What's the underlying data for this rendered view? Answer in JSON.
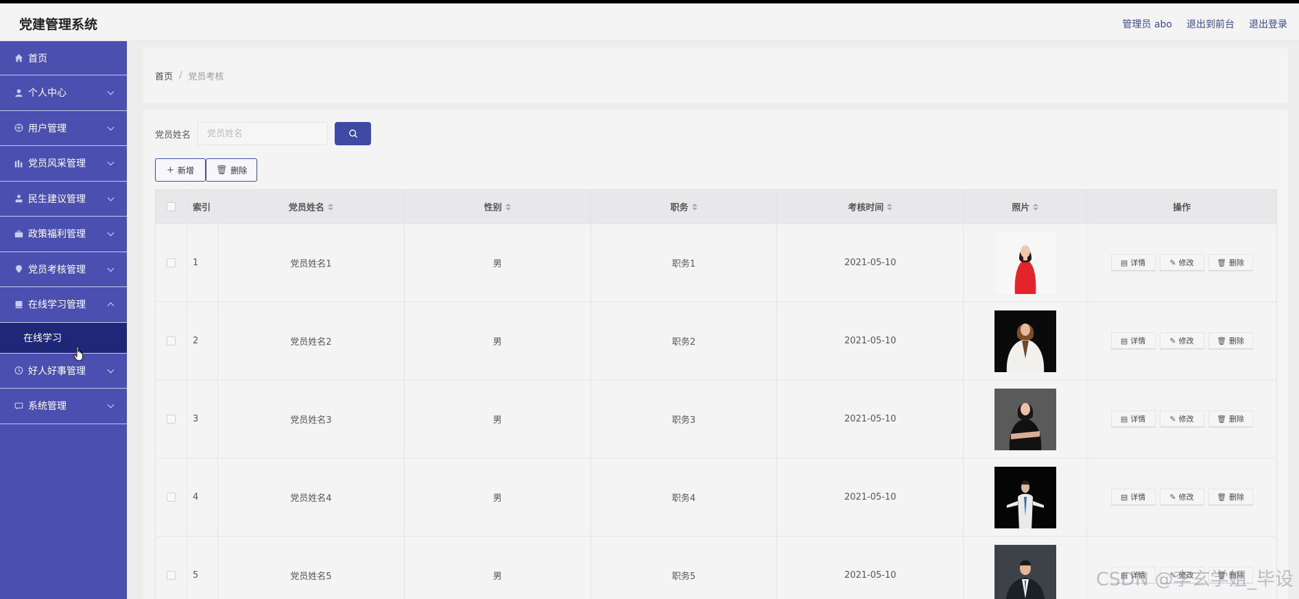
{
  "app": {
    "title": "党建管理系统"
  },
  "header": {
    "user": "管理员 abo",
    "front": "退出到前台",
    "logout": "退出登录"
  },
  "sidebar": {
    "items": [
      {
        "label": "首页",
        "icon": "home-icon"
      },
      {
        "label": "个人中心",
        "icon": "user-icon"
      },
      {
        "label": "用户管理",
        "icon": "users-icon"
      },
      {
        "label": "党员风采管理",
        "icon": "chart-icon"
      },
      {
        "label": "民生建议管理",
        "icon": "person-icon"
      },
      {
        "label": "政策福利管理",
        "icon": "briefcase-icon"
      },
      {
        "label": "党员考核管理",
        "icon": "location-icon"
      },
      {
        "label": "在线学习管理",
        "icon": "book-icon",
        "expanded": true,
        "sub": "在线学习"
      },
      {
        "label": "好人好事管理",
        "icon": "clock-icon"
      },
      {
        "label": "系统管理",
        "icon": "message-icon"
      }
    ]
  },
  "breadcrumb": {
    "home": "首页",
    "sep": "/",
    "current": "党员考核"
  },
  "search": {
    "label": "党员姓名",
    "placeholder": "党员姓名",
    "value": ""
  },
  "toolbar": {
    "add": "新增",
    "delete": "删除"
  },
  "table": {
    "headers": {
      "index": "索引",
      "name": "党员姓名",
      "gender": "性别",
      "position": "职务",
      "time": "考核时间",
      "photo": "照片",
      "ops": "操作"
    },
    "ops": {
      "detail": "详情",
      "edit": "修改",
      "delete": "删除"
    },
    "rows": [
      {
        "index": "1",
        "name": "党员姓名1",
        "gender": "男",
        "position": "职务1",
        "time": "2021-05-10",
        "photo": "woman-red-dress"
      },
      {
        "index": "2",
        "name": "党员姓名2",
        "gender": "男",
        "position": "职务2",
        "time": "2021-05-10",
        "photo": "woman-white-suit"
      },
      {
        "index": "3",
        "name": "党员姓名3",
        "gender": "男",
        "position": "职务3",
        "time": "2021-05-10",
        "photo": "woman-black-dress"
      },
      {
        "index": "4",
        "name": "党员姓名4",
        "gender": "男",
        "position": "职务4",
        "time": "2021-05-10",
        "photo": "man-white-coat"
      },
      {
        "index": "5",
        "name": "党员姓名5",
        "gender": "男",
        "position": "职务5",
        "time": "2021-05-10",
        "photo": "man-dark-suit"
      }
    ]
  },
  "watermark": "CSDN @李玄学姐_毕设",
  "colors": {
    "sidebar": "#4a4fb0",
    "sidebar_active": "#1e2778",
    "primary": "#3e4aa3"
  }
}
